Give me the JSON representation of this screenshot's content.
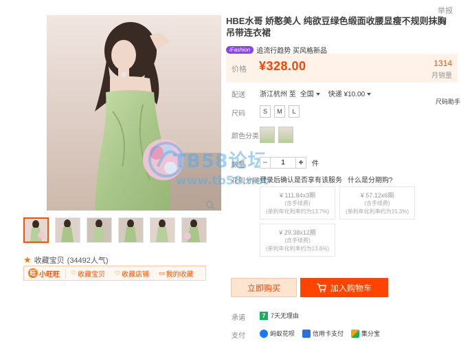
{
  "top_link": "举报",
  "product": {
    "title": "HBE水哥 娇憨美人 纯欲豆绿色缎面收腰显瘦不规则抹胸吊带连衣裙",
    "promo_tag": "iFashion",
    "promo_text": "追流行趋势 买风格新品",
    "price_label": "价格",
    "price": "¥328.00",
    "monthly_sales": "1314",
    "monthly_sales_label": "月销量"
  },
  "delivery": {
    "label": "配送",
    "from": "浙江杭州 至",
    "to": "全国",
    "express": "快递 ¥10.00"
  },
  "size": {
    "label": "尺码",
    "assistant": "尺码助手",
    "options": [
      "S",
      "M",
      "L"
    ]
  },
  "color": {
    "label": "颜色分类"
  },
  "quantity": {
    "label": "数量",
    "value": "1",
    "minus": "−",
    "plus": "+",
    "unit": "件"
  },
  "installments": {
    "label": "花呗分期",
    "note": "登录后确认是否享有该服务",
    "question": "什么是分期购?",
    "plans": [
      {
        "amount": "¥ 111.84x3期",
        "fee": "(含手续费)",
        "rate": "(单利年化利率约为13.7%)"
      },
      {
        "amount": "¥ 57.12x6期",
        "fee": "(含手续费)",
        "rate": "(单利年化利率约为15.3%)"
      },
      {
        "amount": "¥ 29.38x12期",
        "fee": "(含手续费)",
        "rate": "(单利年化利率约为13.6%)"
      }
    ]
  },
  "actions": {
    "buy_now": "立即购买",
    "add_to_cart": "加入购物车"
  },
  "promise": {
    "label": "承诺",
    "icon_text": "7",
    "value": "7天无理由"
  },
  "payment": {
    "label": "支付",
    "methods": [
      {
        "name": "蚂蚁花呗",
        "icon": "huabei-icon",
        "color": "#1677ff"
      },
      {
        "name": "信用卡支付",
        "icon": "credit-card-icon",
        "color": "#2f6fd8"
      },
      {
        "name": "集分宝",
        "icon": "jifenbao-icon",
        "color": "#f5a300"
      }
    ]
  },
  "favorite": {
    "text": "收藏宝贝",
    "count": "(34492人气)"
  },
  "shop_links": {
    "wangwang": "小旺旺",
    "fav_goods": "收藏宝贝",
    "fav_shop": "收藏店铺",
    "my_fav": "我的收藏"
  },
  "watermark": {
    "line1": "TB58论坛",
    "line2": "www.tb58.net"
  },
  "colors": {
    "accent": "#ff5000",
    "price": "#ff4400",
    "dress": "#b7cf9a",
    "watermark": "#5aaae6"
  }
}
